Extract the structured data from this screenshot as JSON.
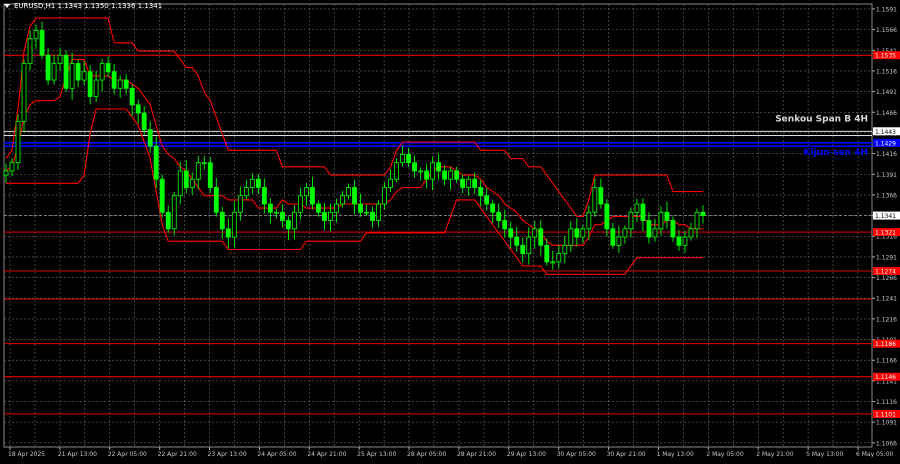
{
  "header": {
    "symbol_line": "EURUSD,H1  1.1343 1.1350 1.1336 1.1341"
  },
  "chart_data": {
    "type": "candlestick",
    "symbol": "EURUSD",
    "timeframe": "H1",
    "ohlc_header": {
      "open": 1.1343,
      "high": 1.135,
      "low": 1.1336,
      "close": 1.1341
    },
    "current_price": 1.1341,
    "ylim": [
      1.1061,
      1.1597
    ],
    "y_ticks": [
      "1.1591",
      "1.1566",
      "1.1541",
      "1.1516",
      "1.1491",
      "1.1466",
      "1.1441",
      "1.1416",
      "1.1391",
      "1.1366",
      "1.1341",
      "1.1316",
      "1.1291",
      "1.1266",
      "1.1241",
      "1.1216",
      "1.1191",
      "1.1166",
      "1.1141",
      "1.1116",
      "1.1091",
      "1.1066"
    ],
    "x_labels": [
      "18 Apr 2025",
      "21 Apr 13:00",
      "22 Apr 05:00",
      "22 Apr 21:00",
      "23 Apr 13:00",
      "24 Apr 05:00",
      "24 Apr 21:00",
      "25 Apr 13:00",
      "28 Apr 05:00",
      "28 Apr 21:00",
      "29 Apr 13:00",
      "30 Apr 05:00",
      "30 Apr 21:00",
      "1 May 13:00",
      "2 May 05:00",
      "2 May 21:00",
      "5 May 13:00",
      "6 May 05:00"
    ],
    "grid": true,
    "background": "#000000",
    "grid_color": "#6b6b6b",
    "candle_up_color": "#00ff00",
    "candle_down_color": "#00ff00",
    "ichimoku_color": "#ff0000",
    "horizontal_levels": [
      {
        "price": 1.1535,
        "label": "1.1535",
        "color": "#ff0000"
      },
      {
        "price": 1.1443,
        "label": "1.1443",
        "color": "#ffffff"
      },
      {
        "price": 1.1438,
        "label": "",
        "color": "#ffffff"
      },
      {
        "price": 1.1429,
        "label": "1.1429",
        "color": "#0000ff",
        "style": "thick"
      },
      {
        "price": 1.1425,
        "label": "",
        "color": "#0000ff",
        "style": "thick"
      },
      {
        "price": 1.1321,
        "label": "1.1321",
        "color": "#ff0000"
      },
      {
        "price": 1.1274,
        "label": "1.1274",
        "color": "#ff0000"
      },
      {
        "price": 1.124,
        "label": "",
        "color": "#ff0000"
      },
      {
        "price": 1.1186,
        "label": "1.1186",
        "color": "#ff0000"
      },
      {
        "price": 1.1146,
        "label": "1.1146",
        "color": "#ff0000"
      },
      {
        "price": 1.1101,
        "label": "1.1101",
        "color": "#ff0000"
      }
    ],
    "annotations": [
      {
        "text": "Senkou Span B 4H",
        "price": 1.1455,
        "color": "#d9d9d9"
      },
      {
        "text": "Kijun-sen 4H",
        "price": 1.1414,
        "color": "#0000ff"
      }
    ],
    "current_price_color": "#ffffff",
    "close_series": [
      1.1395,
      1.1405,
      1.1455,
      1.1525,
      1.1555,
      1.1565,
      1.1535,
      1.1505,
      1.1525,
      1.1535,
      1.1495,
      1.1525,
      1.1505,
      1.1515,
      1.1485,
      1.1505,
      1.1525,
      1.1515,
      1.1495,
      1.1505,
      1.1495,
      1.1475,
      1.1465,
      1.1445,
      1.1425,
      1.1385,
      1.1345,
      1.1325,
      1.1365,
      1.1395,
      1.1375,
      1.1385,
      1.1405,
      1.1405,
      1.1375,
      1.1345,
      1.1325,
      1.1315,
      1.1345,
      1.1365,
      1.1375,
      1.1385,
      1.1375,
      1.1355,
      1.1345,
      1.1345,
      1.1335,
      1.1325,
      1.1345,
      1.1365,
      1.1375,
      1.1355,
      1.1345,
      1.1335,
      1.1345,
      1.1355,
      1.1365,
      1.1375,
      1.1355,
      1.1345,
      1.1345,
      1.1335,
      1.1355,
      1.1375,
      1.1385,
      1.1405,
      1.1415,
      1.1405,
      1.1395,
      1.1395,
      1.1385,
      1.1405,
      1.1395,
      1.1385,
      1.1395,
      1.1385,
      1.1375,
      1.1385,
      1.1375,
      1.1365,
      1.1355,
      1.1345,
      1.1335,
      1.1325,
      1.1315,
      1.1305,
      1.1295,
      1.1315,
      1.1325,
      1.1305,
      1.1285,
      1.1285,
      1.1295,
      1.1305,
      1.1325,
      1.1315,
      1.1325,
      1.1345,
      1.1375,
      1.1355,
      1.1325,
      1.1305,
      1.1315,
      1.1325,
      1.1345,
      1.1355,
      1.1335,
      1.1315,
      1.1325,
      1.1345,
      1.1335,
      1.1315,
      1.1305,
      1.1315,
      1.1325,
      1.1345,
      1.1341
    ]
  }
}
